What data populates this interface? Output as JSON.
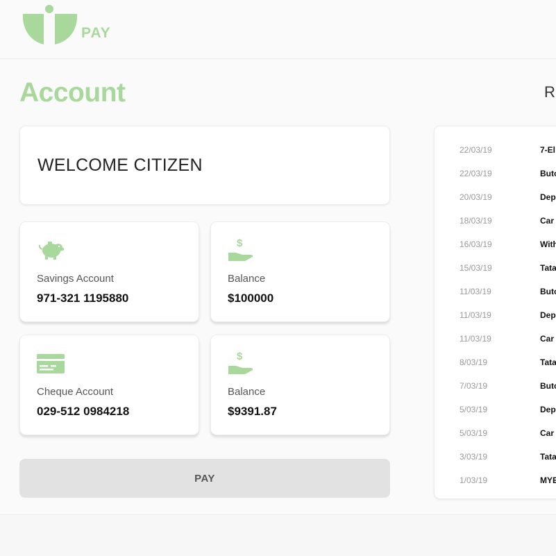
{
  "header": {
    "logo_text": "PAY"
  },
  "page": {
    "title": "Account",
    "recent_title": "R"
  },
  "welcome": {
    "text": "WELCOME CITIZEN"
  },
  "accounts": [
    {
      "icon": "piggy-bank-icon",
      "label": "Savings Account",
      "value": "971-321 1195880"
    },
    {
      "icon": "hand-dollar-icon",
      "label": "Balance",
      "value": "$100000"
    },
    {
      "icon": "cheque-card-icon",
      "label": "Cheque Account",
      "value": "029-512 0984218"
    },
    {
      "icon": "hand-dollar-icon",
      "label": "Balance",
      "value": "$9391.87"
    }
  ],
  "pay_button": {
    "label": "PAY"
  },
  "transactions": [
    {
      "date": "22/03/19",
      "desc": "7-El"
    },
    {
      "date": "22/03/19",
      "desc": "Butc"
    },
    {
      "date": "20/03/19",
      "desc": "Dep"
    },
    {
      "date": "18/03/19",
      "desc": "Car"
    },
    {
      "date": "16/03/19",
      "desc": "With"
    },
    {
      "date": "15/03/19",
      "desc": "Tata"
    },
    {
      "date": "11/03/19",
      "desc": "Butc"
    },
    {
      "date": "11/03/19",
      "desc": "Dep"
    },
    {
      "date": "11/03/19",
      "desc": "Car"
    },
    {
      "date": "8/03/19",
      "desc": "Tata"
    },
    {
      "date": "7/03/19",
      "desc": "Butc"
    },
    {
      "date": "5/03/19",
      "desc": "Dep"
    },
    {
      "date": "5/03/19",
      "desc": "Car"
    },
    {
      "date": "3/03/19",
      "desc": "Tata"
    },
    {
      "date": "1/03/19",
      "desc": "MYE"
    }
  ],
  "colors": {
    "accent": "#a8d89b",
    "button_bg": "#e2e2e2"
  }
}
